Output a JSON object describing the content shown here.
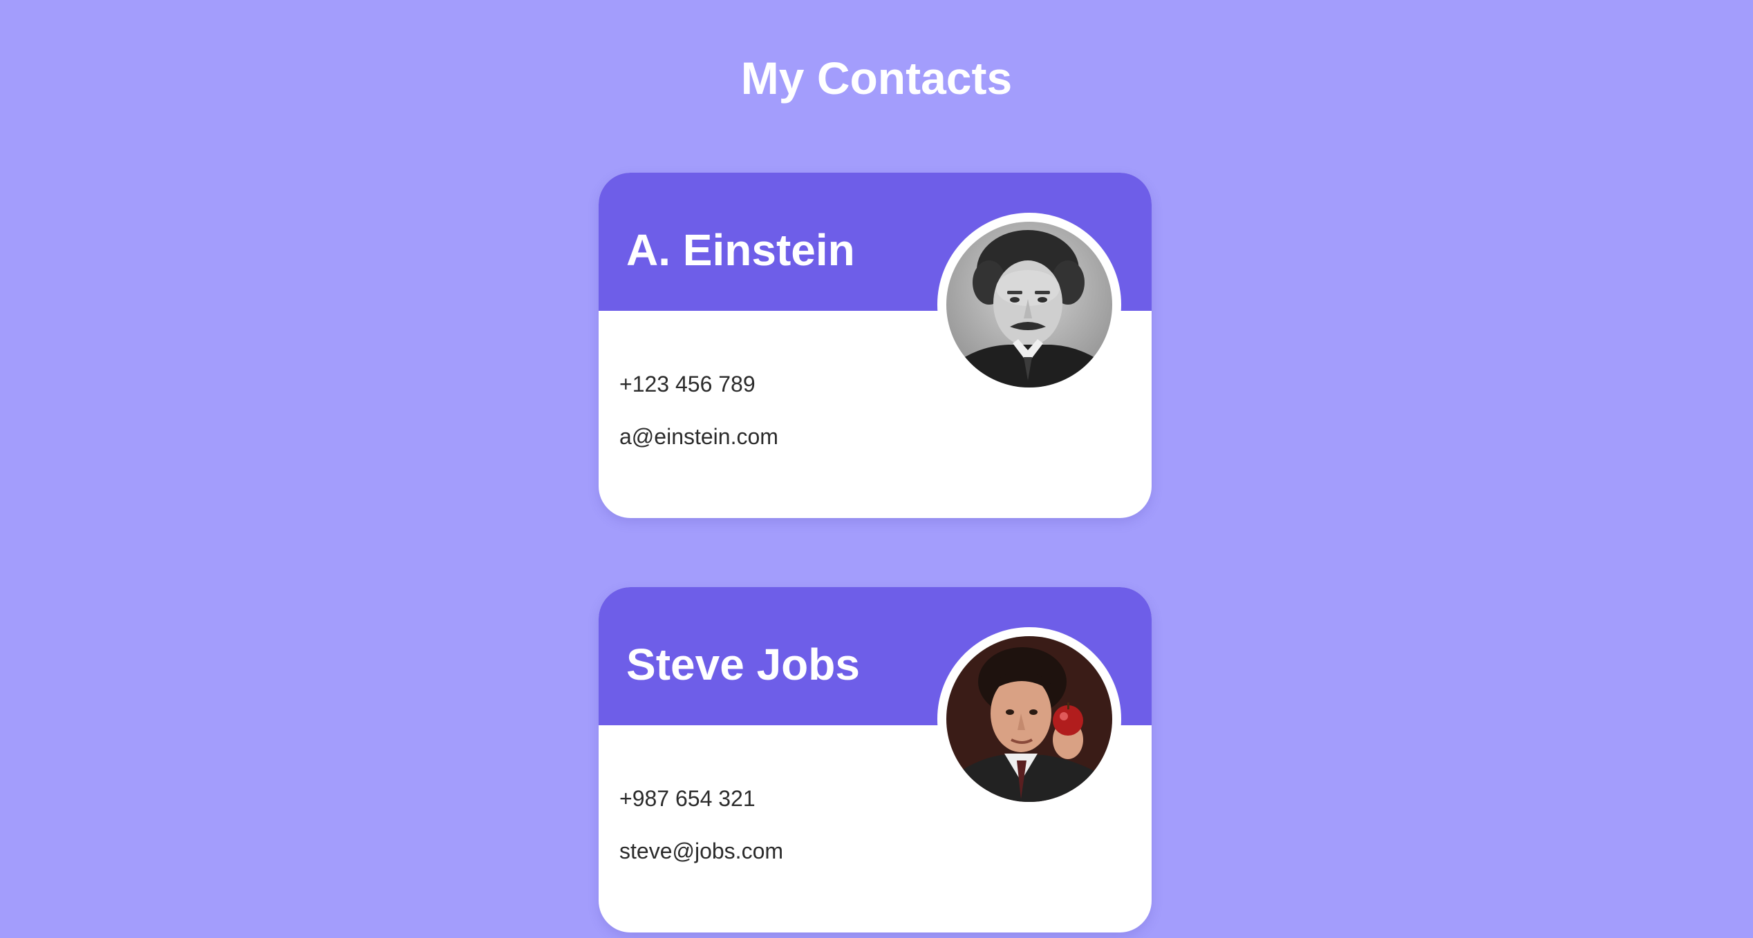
{
  "page": {
    "title": "My Contacts"
  },
  "colors": {
    "background": "#a39dfc",
    "card_header": "#6e5ee8",
    "card_body": "#ffffff",
    "text_dark": "#2b2b2b"
  },
  "contacts": [
    {
      "name": "A. Einstein",
      "phone": "+123 456 789",
      "email": "a@einstein.com",
      "avatar": "portrait-photo-einstein"
    },
    {
      "name": "Steve Jobs",
      "phone": "+987 654 321",
      "email": "steve@jobs.com",
      "avatar": "portrait-photo-steve-jobs"
    }
  ]
}
